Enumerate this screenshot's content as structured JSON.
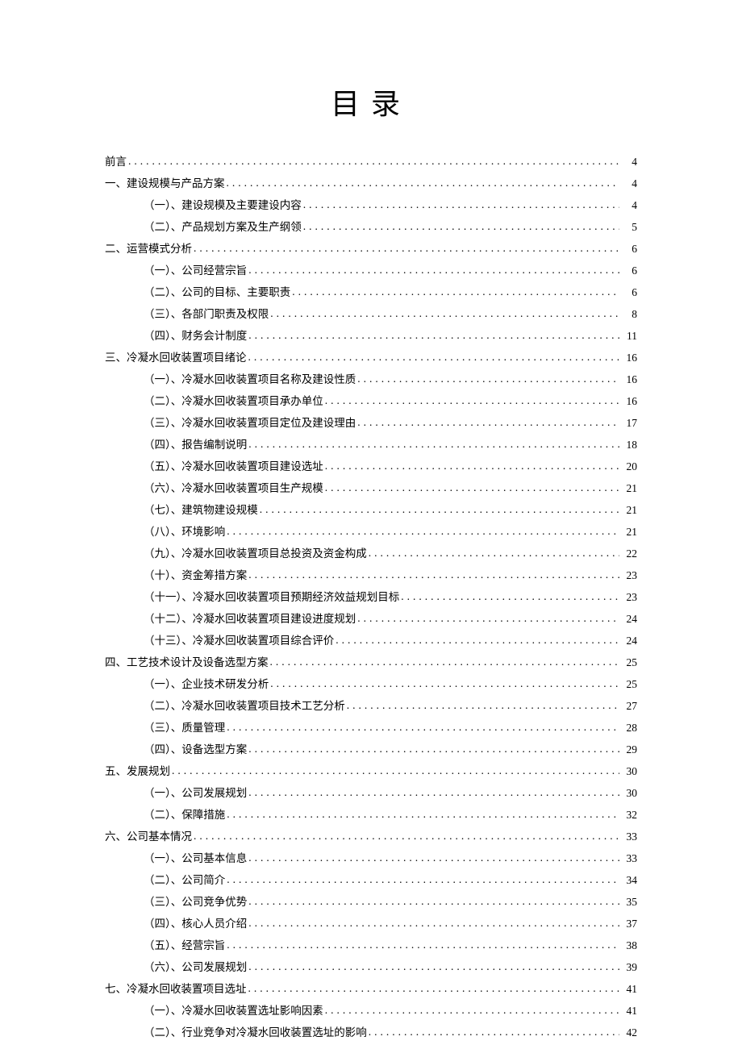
{
  "title": "目录",
  "entries": [
    {
      "level": 0,
      "label": "前言",
      "page": "4"
    },
    {
      "level": 0,
      "label": "一、建设规模与产品方案",
      "page": "4"
    },
    {
      "level": 1,
      "label": "（一）、建设规模及主要建设内容",
      "page": "4"
    },
    {
      "level": 1,
      "label": "（二）、产品规划方案及生产纲领",
      "page": "5"
    },
    {
      "level": 0,
      "label": "二、运营模式分析",
      "page": "6"
    },
    {
      "level": 1,
      "label": "（一）、公司经营宗旨",
      "page": "6"
    },
    {
      "level": 1,
      "label": "（二）、公司的目标、主要职责",
      "page": "6"
    },
    {
      "level": 1,
      "label": "（三）、各部门职责及权限",
      "page": "8"
    },
    {
      "level": 1,
      "label": "（四）、财务会计制度",
      "page": "11"
    },
    {
      "level": 0,
      "label": "三、冷凝水回收装置项目绪论",
      "page": "16"
    },
    {
      "level": 1,
      "label": "（一）、冷凝水回收装置项目名称及建设性质",
      "page": "16"
    },
    {
      "level": 1,
      "label": "（二）、冷凝水回收装置项目承办单位",
      "page": "16"
    },
    {
      "level": 1,
      "label": "（三）、冷凝水回收装置项目定位及建设理由",
      "page": "17"
    },
    {
      "level": 1,
      "label": "（四）、报告编制说明",
      "page": "18"
    },
    {
      "level": 1,
      "label": "（五）、冷凝水回收装置项目建设选址",
      "page": "20"
    },
    {
      "level": 1,
      "label": "（六）、冷凝水回收装置项目生产规模",
      "page": "21"
    },
    {
      "level": 1,
      "label": "（七）、建筑物建设规模",
      "page": "21"
    },
    {
      "level": 1,
      "label": "（八）、环境影响",
      "page": "21"
    },
    {
      "level": 1,
      "label": "（九）、冷凝水回收装置项目总投资及资金构成",
      "page": "22"
    },
    {
      "level": 1,
      "label": "（十）、资金筹措方案",
      "page": "23"
    },
    {
      "level": 1,
      "label": "（十一）、冷凝水回收装置项目预期经济效益规划目标",
      "page": "23"
    },
    {
      "level": 1,
      "label": "（十二）、冷凝水回收装置项目建设进度规划",
      "page": "24"
    },
    {
      "level": 1,
      "label": "（十三）、冷凝水回收装置项目综合评价",
      "page": "24"
    },
    {
      "level": 0,
      "label": "四、工艺技术设计及设备选型方案",
      "page": "25"
    },
    {
      "level": 1,
      "label": "（一）、企业技术研发分析",
      "page": "25"
    },
    {
      "level": 1,
      "label": "（二）、冷凝水回收装置项目技术工艺分析",
      "page": "27"
    },
    {
      "level": 1,
      "label": "（三）、质量管理",
      "page": "28"
    },
    {
      "level": 1,
      "label": "（四）、设备选型方案",
      "page": "29"
    },
    {
      "level": 0,
      "label": "五、发展规划",
      "page": "30"
    },
    {
      "level": 1,
      "label": "（一）、公司发展规划",
      "page": "30"
    },
    {
      "level": 1,
      "label": "（二）、保障措施",
      "page": "32"
    },
    {
      "level": 0,
      "label": "六、公司基本情况",
      "page": "33"
    },
    {
      "level": 1,
      "label": "（一）、公司基本信息",
      "page": "33"
    },
    {
      "level": 1,
      "label": "（二）、公司简介",
      "page": "34"
    },
    {
      "level": 1,
      "label": "（三）、公司竞争优势",
      "page": "35"
    },
    {
      "level": 1,
      "label": "（四）、核心人员介绍",
      "page": "37"
    },
    {
      "level": 1,
      "label": "（五）、经营宗旨",
      "page": "38"
    },
    {
      "level": 1,
      "label": "（六）、公司发展规划",
      "page": "39"
    },
    {
      "level": 0,
      "label": "七、冷凝水回收装置项目选址",
      "page": "41"
    },
    {
      "level": 1,
      "label": "（一）、冷凝水回收装置选址影响因素",
      "page": "41"
    },
    {
      "level": 1,
      "label": "（二）、行业竞争对冷凝水回收装置选址的影响",
      "page": "42"
    }
  ]
}
